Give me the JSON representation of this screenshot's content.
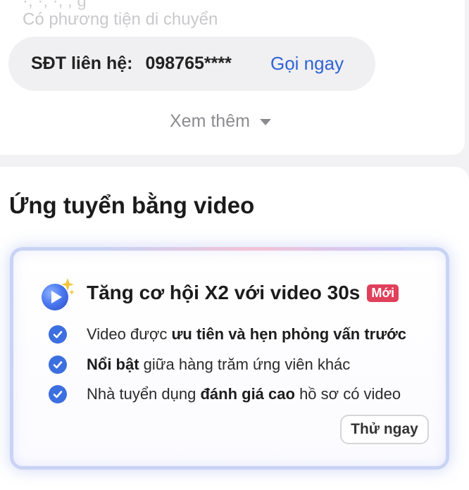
{
  "top_card": {
    "faded_line": "Có phương tiện di chuyển",
    "faded_line_above": "·, ·, ·,  ,  g",
    "phone_label": "SĐT liên hệ:",
    "phone_number": "098765****",
    "call_now": "Gọi ngay",
    "see_more": "Xem thêm"
  },
  "video_section": {
    "title": "Ứng tuyển bằng video",
    "promo": {
      "title": "Tăng cơ hội X2 với video 30s",
      "badge": "Mới",
      "benefits": [
        {
          "prefix": "Video được ",
          "bold": "ưu tiên và hẹn phỏng vấn trước",
          "suffix": ""
        },
        {
          "prefix": "",
          "bold": "Nổi bật",
          "suffix": " giữa hàng trăm ứng viên khác"
        },
        {
          "prefix": "Nhà tuyển dụng ",
          "bold": "đánh giá cao",
          "suffix": " hồ sơ có video"
        }
      ],
      "try_button": "Thử ngay"
    }
  },
  "colors": {
    "accent_blue": "#2f63d6",
    "badge_red": "#e0405a",
    "check_blue": "#3c6fe0"
  },
  "icons": {
    "promo_icon": "video-play-sparkle-icon",
    "check_icon": "check-circle-icon",
    "see_more_icon": "caret-down-icon"
  }
}
